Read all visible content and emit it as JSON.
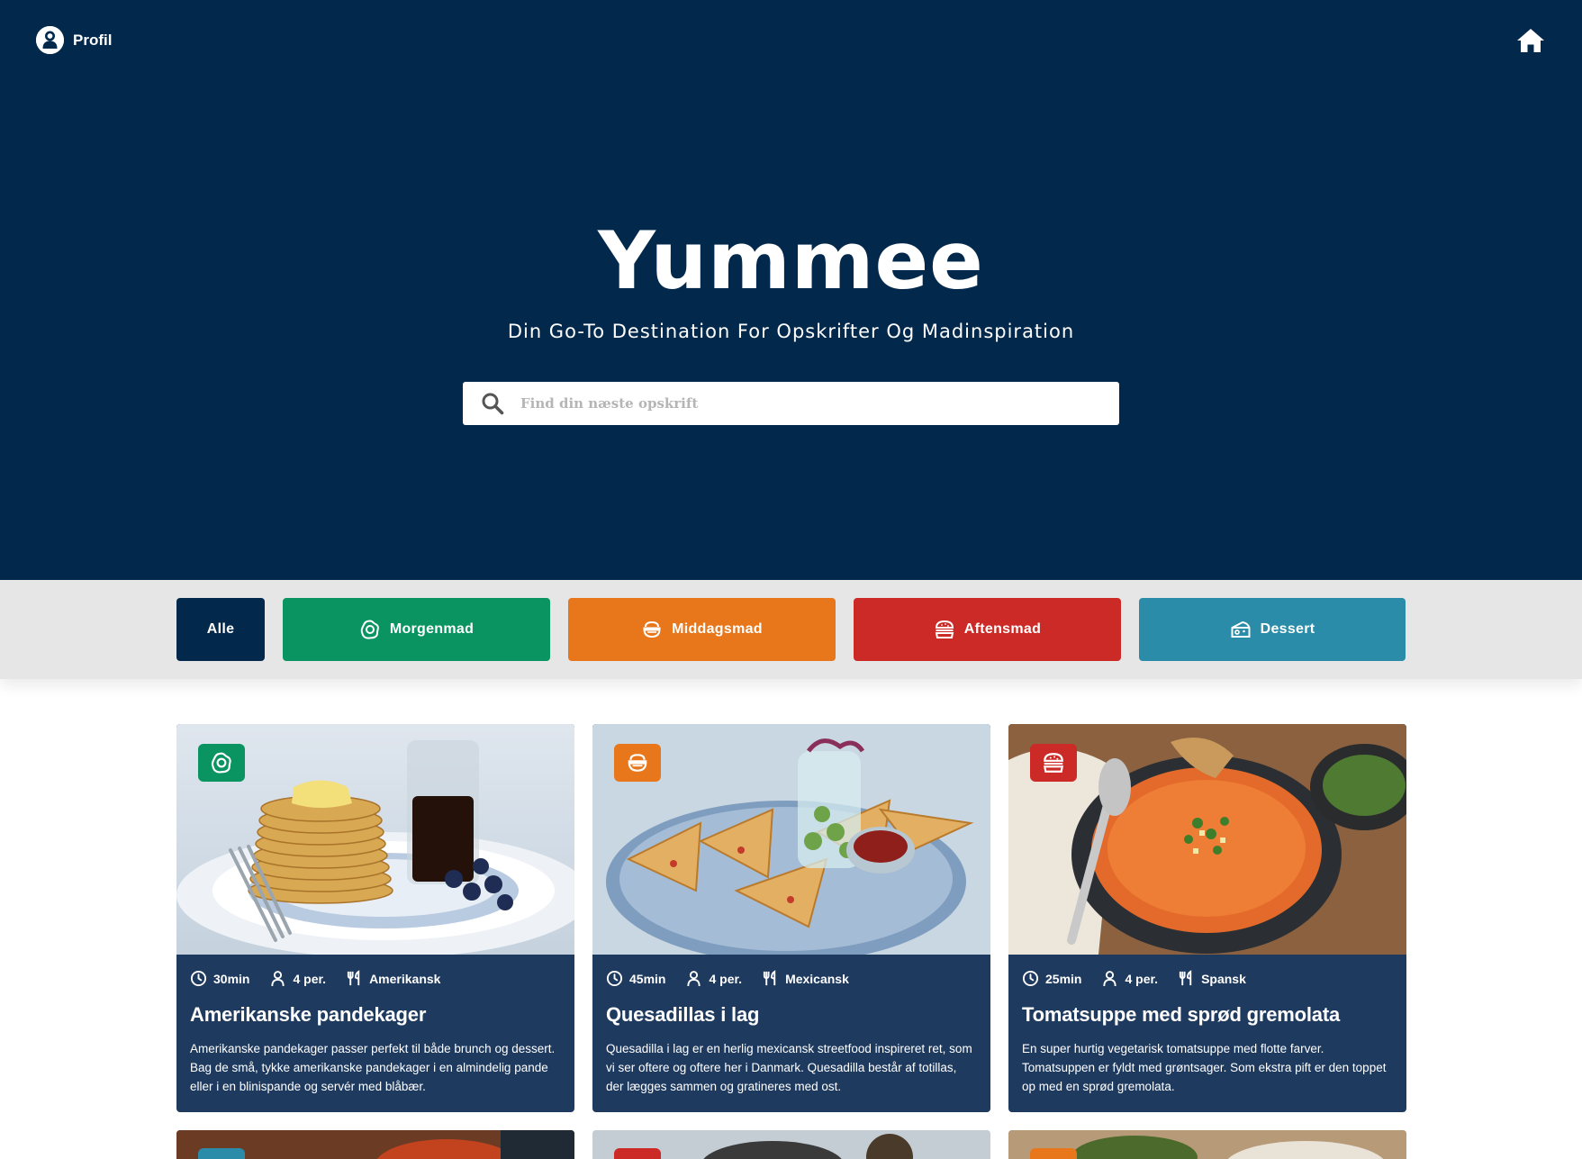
{
  "header": {
    "profile_label": "Profil",
    "profile_icon": "user-circle-icon",
    "home_icon": "home-icon"
  },
  "hero": {
    "title": "Yummee",
    "tagline": "Din Go-To Destination For Opskrifter Og Madinspiration",
    "search_placeholder": "Find din næste opskrift",
    "search_value": ""
  },
  "filters": [
    {
      "label": "Alle",
      "color": "#02284b",
      "icon": ""
    },
    {
      "label": "Morgenmad",
      "color": "#0a9461",
      "icon": "egg-icon"
    },
    {
      "label": "Middagsmad",
      "color": "#e8761a",
      "icon": "bowl-icon"
    },
    {
      "label": "Aftensmad",
      "color": "#cc2a26",
      "icon": "burger-icon"
    },
    {
      "label": "Dessert",
      "color": "#2a8ca8",
      "icon": "cheese-icon"
    }
  ],
  "recipes": [
    {
      "time": "30min",
      "persons": "4 per.",
      "cuisine": "Amerikansk",
      "title": "Amerikanske pandekager",
      "description": "Amerikanske pandekager passer perfekt til både brunch og dessert. Bag de små, tykke amerikanske pandekager i en almindelig pande eller i en blinispande og servér med blåbær.",
      "category_color": "#0a9461",
      "category_icon": "egg-icon"
    },
    {
      "time": "45min",
      "persons": "4 per.",
      "cuisine": "Mexicansk",
      "title": "Quesadillas i lag",
      "description": "Quesadilla i lag er en herlig mexicansk streetfood inspireret ret, som vi ser oftere og oftere her i Danmark. Quesadilla består af totillas, der lægges sammen og gratineres med ost.",
      "category_color": "#e8761a",
      "category_icon": "bowl-icon"
    },
    {
      "time": "25min",
      "persons": "4 per.",
      "cuisine": "Spansk",
      "title": "Tomatsuppe med sprød gremolata",
      "description": "En super hurtig vegetarisk tomatsuppe med flotte farver. Tomatsuppen er fyldt med grøntsager. Som ekstra pift er den toppet op med en sprød gremolata.",
      "category_color": "#cc2a26",
      "category_icon": "burger-icon"
    }
  ],
  "colors": {
    "hero_bg": "#02284b",
    "card_bg": "#1e3a5f",
    "filter_bar_bg": "#e6e6e6"
  }
}
